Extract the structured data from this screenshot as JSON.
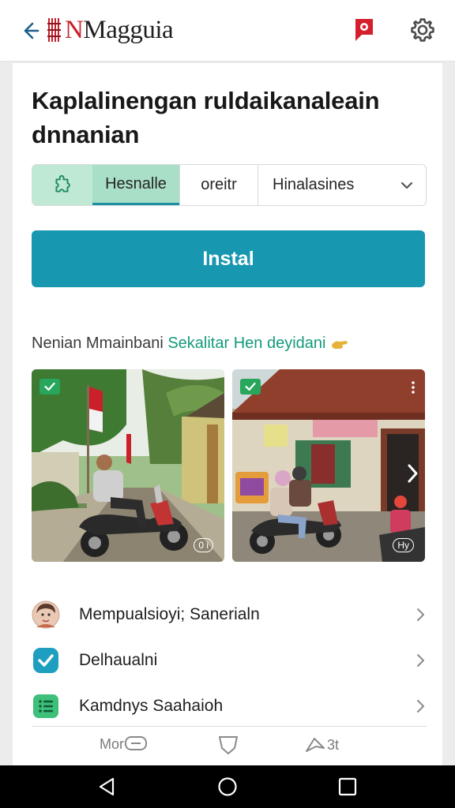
{
  "appbar": {
    "brand_red": "M",
    "brand_rest": "agguia",
    "brand_prefix": "N",
    "icons": {
      "back": "back-arrow-icon",
      "flag": "flag-icon",
      "settings": "gear-icon"
    }
  },
  "page": {
    "title": "Kaplalinengan ruldaikanaleain dnnanian"
  },
  "segments": {
    "tab_a": "Hesnalle",
    "tab_b": "oreitr",
    "select_value": "Hinalasines"
  },
  "install_label": "Instal",
  "section": {
    "heading_plain": "Nenian Mmainbani ",
    "heading_highlight": "Sekalitar Hen deyidani"
  },
  "photos": [
    {
      "badge": "0 i"
    },
    {
      "badge": "Hy"
    }
  ],
  "list": [
    {
      "label": "Mempualsioyi; Sanerialn",
      "icon": "avatar-icon"
    },
    {
      "label": "Delhaualni",
      "icon": "check-badge-icon"
    },
    {
      "label": "Kamdnys Saahaioh",
      "icon": "list-icon"
    }
  ],
  "bottom_nav": [
    {
      "label": "Mor"
    },
    {
      "label": ""
    },
    {
      "label": "3t"
    }
  ],
  "colors": {
    "accent": "#1797b0",
    "segment_green": "#a9dfc6",
    "brand_red": "#c8202c",
    "check_green": "#27a65c"
  }
}
